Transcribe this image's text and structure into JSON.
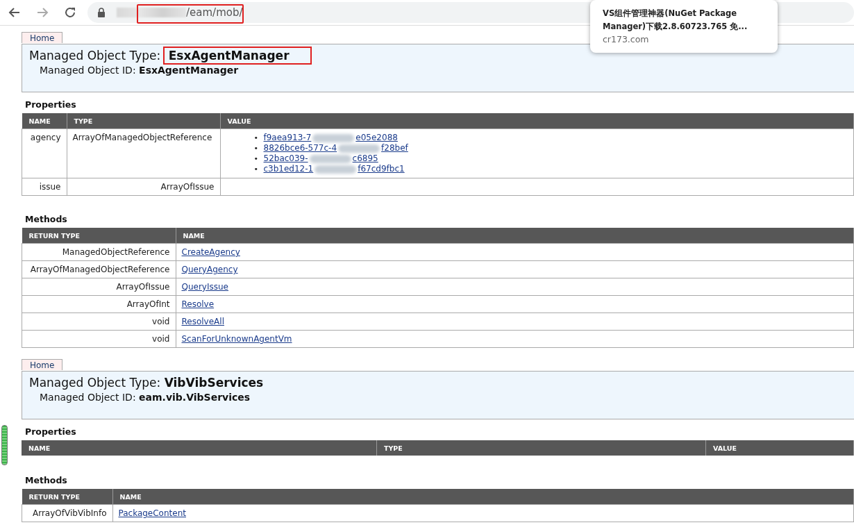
{
  "browser": {
    "url_visible": "/eam/mob/"
  },
  "popup": {
    "title": "VS组件管理神器(NuGet Package Manager)下载2.8.60723.765 免...",
    "domain": "cr173.com"
  },
  "objects": [
    {
      "home": "Home",
      "type_label": "Managed Object Type:",
      "type": "EsxAgentManager",
      "id_label": "Managed Object ID:",
      "id": "EsxAgentManager",
      "highlight_type": true,
      "properties": {
        "title": "Properties",
        "columns": [
          "NAME",
          "TYPE",
          "VALUE"
        ],
        "rows": [
          {
            "name": "agency",
            "type": "ArrayOfManagedObjectReference",
            "links": [
              {
                "bullet": "•",
                "start": "f9aea913-7",
                "end": "e05e2088"
              },
              {
                "bullet": "•",
                "start": "8826bce6-577c-4",
                "end": "f28bef"
              },
              {
                "bullet": "•",
                "start": "52bac039-",
                "end": "c6895"
              },
              {
                "bullet": "•",
                "start": "c3b1ed12-1",
                "end": "f67cd9fbc1"
              }
            ]
          },
          {
            "name": "issue",
            "type": "ArrayOfIssue"
          }
        ]
      },
      "methods": {
        "title": "Methods",
        "columns": [
          "RETURN TYPE",
          "NAME"
        ],
        "rows": [
          {
            "return": "ManagedObjectReference",
            "name": "CreateAgency"
          },
          {
            "return": "ArrayOfManagedObjectReference",
            "name": "QueryAgency"
          },
          {
            "return": "ArrayOfIssue",
            "name": "QueryIssue"
          },
          {
            "return": "ArrayOfInt",
            "name": "Resolve"
          },
          {
            "return": "void",
            "name": "ResolveAll"
          },
          {
            "return": "void",
            "name": "ScanForUnknownAgentVm"
          }
        ]
      }
    },
    {
      "home": "Home",
      "type_label": "Managed Object Type:",
      "type": "VibVibServices",
      "id_label": "Managed Object ID:",
      "id": "eam.vib.VibServices",
      "highlight_type": false,
      "properties": {
        "title": "Properties",
        "columns": [
          "NAME",
          "TYPE",
          "VALUE"
        ]
      },
      "methods": {
        "title": "Methods",
        "columns": [
          "RETURN TYPE",
          "NAME"
        ],
        "rows": [
          {
            "return": "ArrayOfVibVibInfo",
            "name": "PackageContent"
          }
        ]
      }
    }
  ]
}
